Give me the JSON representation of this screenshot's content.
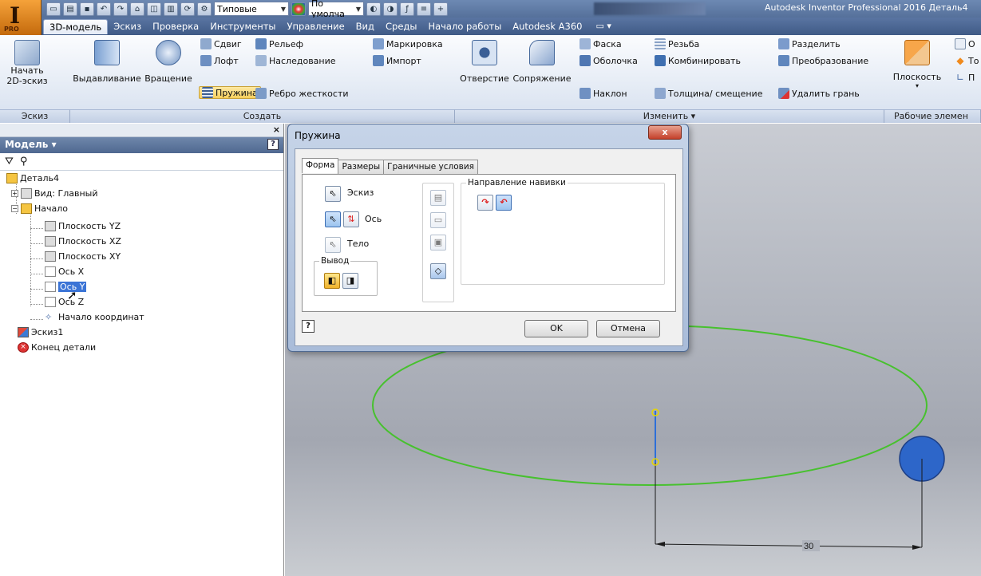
{
  "app": {
    "logo_letter": "I",
    "logo_badge": "PRO",
    "title": "Autodesk Inventor Professional 2016   Деталь4",
    "qat_style_combo": "Типовые",
    "qat_appearance_combo": "По умолча"
  },
  "tabs": [
    {
      "label": "3D-модель",
      "active": true
    },
    {
      "label": "Эскиз"
    },
    {
      "label": "Проверка"
    },
    {
      "label": "Инструменты"
    },
    {
      "label": "Управление"
    },
    {
      "label": "Вид"
    },
    {
      "label": "Среды"
    },
    {
      "label": "Начало работы"
    },
    {
      "label": "Autodesk A360"
    }
  ],
  "tabs_extra": "▭ ▾",
  "ribbon": {
    "sketch_group": {
      "start_sketch": "Начать",
      "start_sketch2": "2D-эскиз",
      "label": "Эскиз"
    },
    "create_group": {
      "extrude": "Выдавливание",
      "revolve": "Вращение",
      "sweep": "Сдвиг",
      "loft": "Лофт",
      "coil": "Пружина",
      "emboss": "Рельеф",
      "derive": "Наследование",
      "rib": "Ребро жесткости",
      "mark": "Маркировка",
      "import": "Импорт",
      "label": "Создать"
    },
    "modify_group": {
      "hole": "Отверстие",
      "fillet": "Сопряжение",
      "chamfer": "Фаска",
      "shell": "Оболочка",
      "draft": "Наклон",
      "thread": "Резьба",
      "combine": "Комбинировать",
      "thicken": "Толщина/ смещение",
      "split": "Разделить",
      "direct": "Преобразование",
      "delete_face": "Удалить грань",
      "label": "Изменить ▾"
    },
    "work_group": {
      "plane": "Плоскость",
      "axis_cut": "О",
      "point_cut": "То",
      "ucs_cut": "П",
      "label": "Рабочие элемен"
    }
  },
  "browser": {
    "close": "×",
    "header": "Модель ▾",
    "help": "?",
    "tree": {
      "root": "Деталь4",
      "view": "Вид: Главный",
      "origin": "Начало",
      "plane_yz": "Плоскость YZ",
      "plane_xz": "Плоскость XZ",
      "plane_xy": "Плоскость XY",
      "axis_x": "Ось X",
      "axis_y": "Ось Y",
      "axis_z": "Ось Z",
      "center_point": "Начало координат",
      "sketch1": "Эскиз1",
      "end_of_part": "Конец детали"
    }
  },
  "dialog": {
    "title": "Пружина",
    "close": "x",
    "tabs": [
      "Форма",
      "Размеры",
      "Граничные условия"
    ],
    "profile": "Эскиз",
    "axis": "Ось",
    "solid": "Тело",
    "output_legend": "Вывод",
    "rotation_legend": "Направление навивки",
    "help": "?",
    "ok": "OK",
    "cancel": "Отмена"
  },
  "viewport": {
    "dimension": "30"
  }
}
